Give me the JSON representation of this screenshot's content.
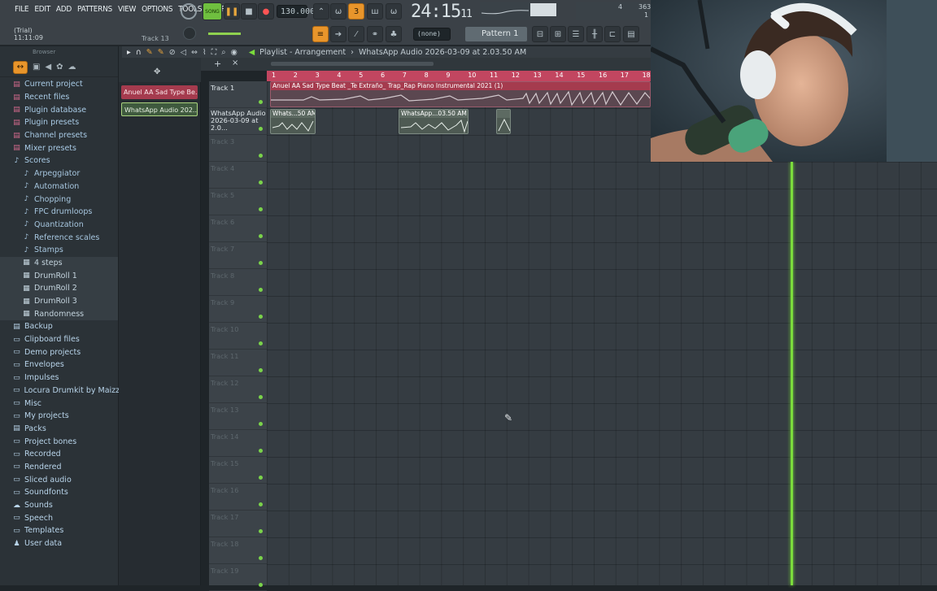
{
  "menu": [
    "FILE",
    "EDIT",
    "ADD",
    "PATTERNS",
    "VIEW",
    "OPTIONS",
    "TOOLS",
    "HELP"
  ],
  "transport": {
    "mode": "SONG",
    "tempo": "130.000",
    "time": "24:15",
    "time_sub": "11",
    "meter_top": "4",
    "meter_cpu": "363",
    "meter_poly": "1"
  },
  "hint": {
    "line1": "(Trial)",
    "line2": "11:11:09",
    "track": "Track 13"
  },
  "toolbar2": {
    "pattern_select": "(none)",
    "pattern_name": "Pattern 1"
  },
  "browser": {
    "header": "Browser",
    "items": [
      {
        "label": "Current project",
        "icon": "project-icon",
        "kind": "top"
      },
      {
        "label": "Recent files",
        "icon": "recent-icon",
        "kind": "top"
      },
      {
        "label": "Plugin database",
        "icon": "plugin-db-icon",
        "kind": "top"
      },
      {
        "label": "Plugin presets",
        "icon": "plugin-presets-icon",
        "kind": "top"
      },
      {
        "label": "Channel presets",
        "icon": "channel-presets-icon",
        "kind": "top"
      },
      {
        "label": "Mixer presets",
        "icon": "mixer-presets-icon",
        "kind": "top"
      },
      {
        "label": "Scores",
        "icon": "note-icon",
        "kind": "top"
      },
      {
        "label": "Arpeggiator",
        "icon": "note-icon",
        "kind": "sub"
      },
      {
        "label": "Automation",
        "icon": "note-icon",
        "kind": "sub"
      },
      {
        "label": "Chopping",
        "icon": "note-icon",
        "kind": "sub"
      },
      {
        "label": "FPC drumloops",
        "icon": "note-icon",
        "kind": "sub"
      },
      {
        "label": "Quantization",
        "icon": "note-icon",
        "kind": "sub"
      },
      {
        "label": "Reference scales",
        "icon": "note-icon",
        "kind": "sub"
      },
      {
        "label": "Stamps",
        "icon": "note-icon",
        "kind": "sub"
      },
      {
        "label": "4 steps",
        "icon": "score-file-icon",
        "kind": "sub2"
      },
      {
        "label": "DrumRoll 1",
        "icon": "score-file-icon",
        "kind": "sub2"
      },
      {
        "label": "DrumRoll 2",
        "icon": "score-file-icon",
        "kind": "sub2"
      },
      {
        "label": "DrumRoll 3",
        "icon": "score-file-icon",
        "kind": "sub2"
      },
      {
        "label": "Randomness",
        "icon": "score-file-icon",
        "kind": "sub2"
      },
      {
        "label": "Backup",
        "icon": "backup-icon",
        "kind": "folder"
      },
      {
        "label": "Clipboard files",
        "icon": "folder-icon",
        "kind": "folder"
      },
      {
        "label": "Demo projects",
        "icon": "folder-icon",
        "kind": "folder"
      },
      {
        "label": "Envelopes",
        "icon": "folder-icon",
        "kind": "folder"
      },
      {
        "label": "Impulses",
        "icon": "folder-icon",
        "kind": "folder"
      },
      {
        "label": "Locura Drumkit by Maizzeno",
        "icon": "folder-icon",
        "kind": "folder"
      },
      {
        "label": "Misc",
        "icon": "folder-icon",
        "kind": "folder"
      },
      {
        "label": "My projects",
        "icon": "folder-icon",
        "kind": "folder"
      },
      {
        "label": "Packs",
        "icon": "packs-icon",
        "kind": "folder"
      },
      {
        "label": "Project bones",
        "icon": "folder-icon",
        "kind": "folder"
      },
      {
        "label": "Recorded",
        "icon": "folder-icon",
        "kind": "folder"
      },
      {
        "label": "Rendered",
        "icon": "folder-icon",
        "kind": "folder"
      },
      {
        "label": "Sliced audio",
        "icon": "folder-icon",
        "kind": "folder"
      },
      {
        "label": "Soundfonts",
        "icon": "folder-icon",
        "kind": "folder"
      },
      {
        "label": "Sounds",
        "icon": "cloud-icon",
        "kind": "folder"
      },
      {
        "label": "Speech",
        "icon": "folder-icon",
        "kind": "folder"
      },
      {
        "label": "Templates",
        "icon": "folder-icon",
        "kind": "folder"
      },
      {
        "label": "User data",
        "icon": "user-icon",
        "kind": "folder"
      }
    ]
  },
  "picker": {
    "clips": [
      "Anuel AA Sad Type Be...",
      "WhatsApp Audio 202..."
    ]
  },
  "playlist": {
    "title": "Playlist - Arrangement",
    "breadcrumb": "WhatsApp Audio 2026-03-09 at 2.03.50 AM",
    "bars": [
      "1",
      "2",
      "3",
      "4",
      "5",
      "6",
      "7",
      "8",
      "9",
      "10",
      "11",
      "12",
      "13",
      "14",
      "15",
      "16",
      "17",
      "18"
    ],
    "tracks": [
      {
        "name": "Track 1",
        "active": true
      },
      {
        "name": "WhatsApp Audio 2026-03-09 at 2.0...",
        "active": true
      },
      {
        "name": "Track 3",
        "active": false
      },
      {
        "name": "Track 4",
        "active": false
      },
      {
        "name": "Track 5",
        "active": false
      },
      {
        "name": "Track 6",
        "active": false
      },
      {
        "name": "Track 7",
        "active": false
      },
      {
        "name": "Track 8",
        "active": false
      },
      {
        "name": "Track 9",
        "active": false
      },
      {
        "name": "Track 10",
        "active": false
      },
      {
        "name": "Track 11",
        "active": false
      },
      {
        "name": "Track 12",
        "active": false
      },
      {
        "name": "Track 13",
        "active": false
      },
      {
        "name": "Track 14",
        "active": false
      },
      {
        "name": "Track 15",
        "active": false
      },
      {
        "name": "Track 16",
        "active": false
      },
      {
        "name": "Track 17",
        "active": false
      },
      {
        "name": "Track 18",
        "active": false
      },
      {
        "name": "Track 19",
        "active": false
      }
    ],
    "clips": {
      "beat": "Anuel AA Sad Type Beat _Te Extraño_ Trap_Rap Piano Instrumental 2021 (1)",
      "wa1": "Whats...50 AM",
      "wa2": "WhatsApp...03.50 AM",
      "wa3": ""
    }
  },
  "colors": {
    "accent_orange": "#e8952b",
    "ruler": "#c24660",
    "playhead": "#7bdc3c",
    "audio_clip": "#4e5a53"
  }
}
